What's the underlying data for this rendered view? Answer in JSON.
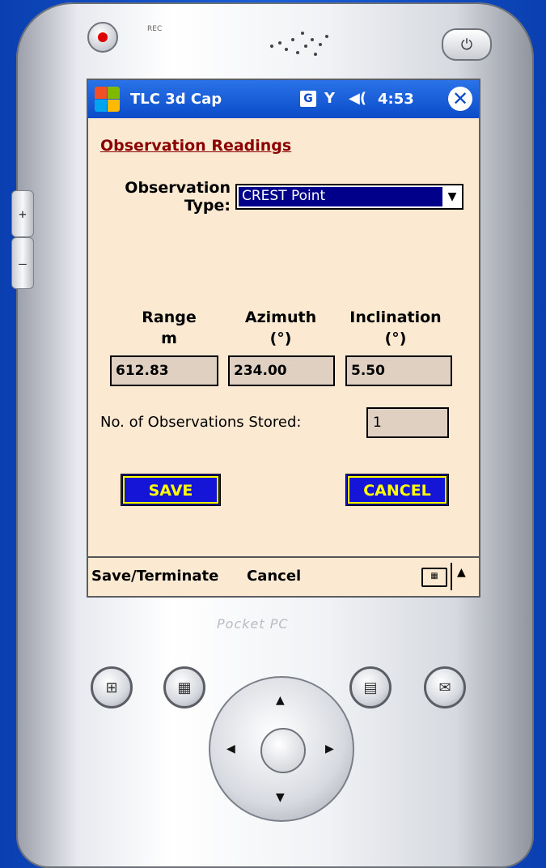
{
  "device": {
    "rec_label": "REC",
    "brand": "Pocket PC",
    "side_plus": "+",
    "side_minus": "–",
    "power_glyph": "⏻",
    "hw_buttons": [
      "start-button-glyph",
      "calendar-glyph",
      "contacts-glyph",
      "inbox-glyph"
    ]
  },
  "titlebar": {
    "app_title": "TLC 3d Cap",
    "g_icon": "G",
    "signal_glyph": "Y",
    "volume_glyph": "◀(",
    "time": "4:53",
    "close_glyph": "✕"
  },
  "form": {
    "heading": "Observation Readings",
    "observation_type_label_1": "Observation",
    "observation_type_label_2": "Type:",
    "observation_type_value": "CREST Point",
    "columns": [
      {
        "label_1": "Range",
        "label_2": "m",
        "value": "612.83"
      },
      {
        "label_1": "Azimuth",
        "label_2": "(°)",
        "value": "234.00"
      },
      {
        "label_1": "Inclination",
        "label_2": "(°)",
        "value": "5.50"
      }
    ],
    "stored_label": "No. of Observations Stored:",
    "stored_value": "1",
    "save_label": "SAVE",
    "cancel_label": "CANCEL"
  },
  "menubar": {
    "left_item": "Save/Terminate",
    "right_item": "Cancel",
    "keyboard_glyph": "▦",
    "up_glyph": "▲"
  },
  "colors": {
    "titlebar": "#0b4bc9",
    "form_bg": "#fbe9d2",
    "heading": "#8b0000",
    "select_highlight": "#00008b",
    "button_bg": "#1515d8",
    "button_text": "#ffff00",
    "field_bg": "#e0d0c2"
  }
}
